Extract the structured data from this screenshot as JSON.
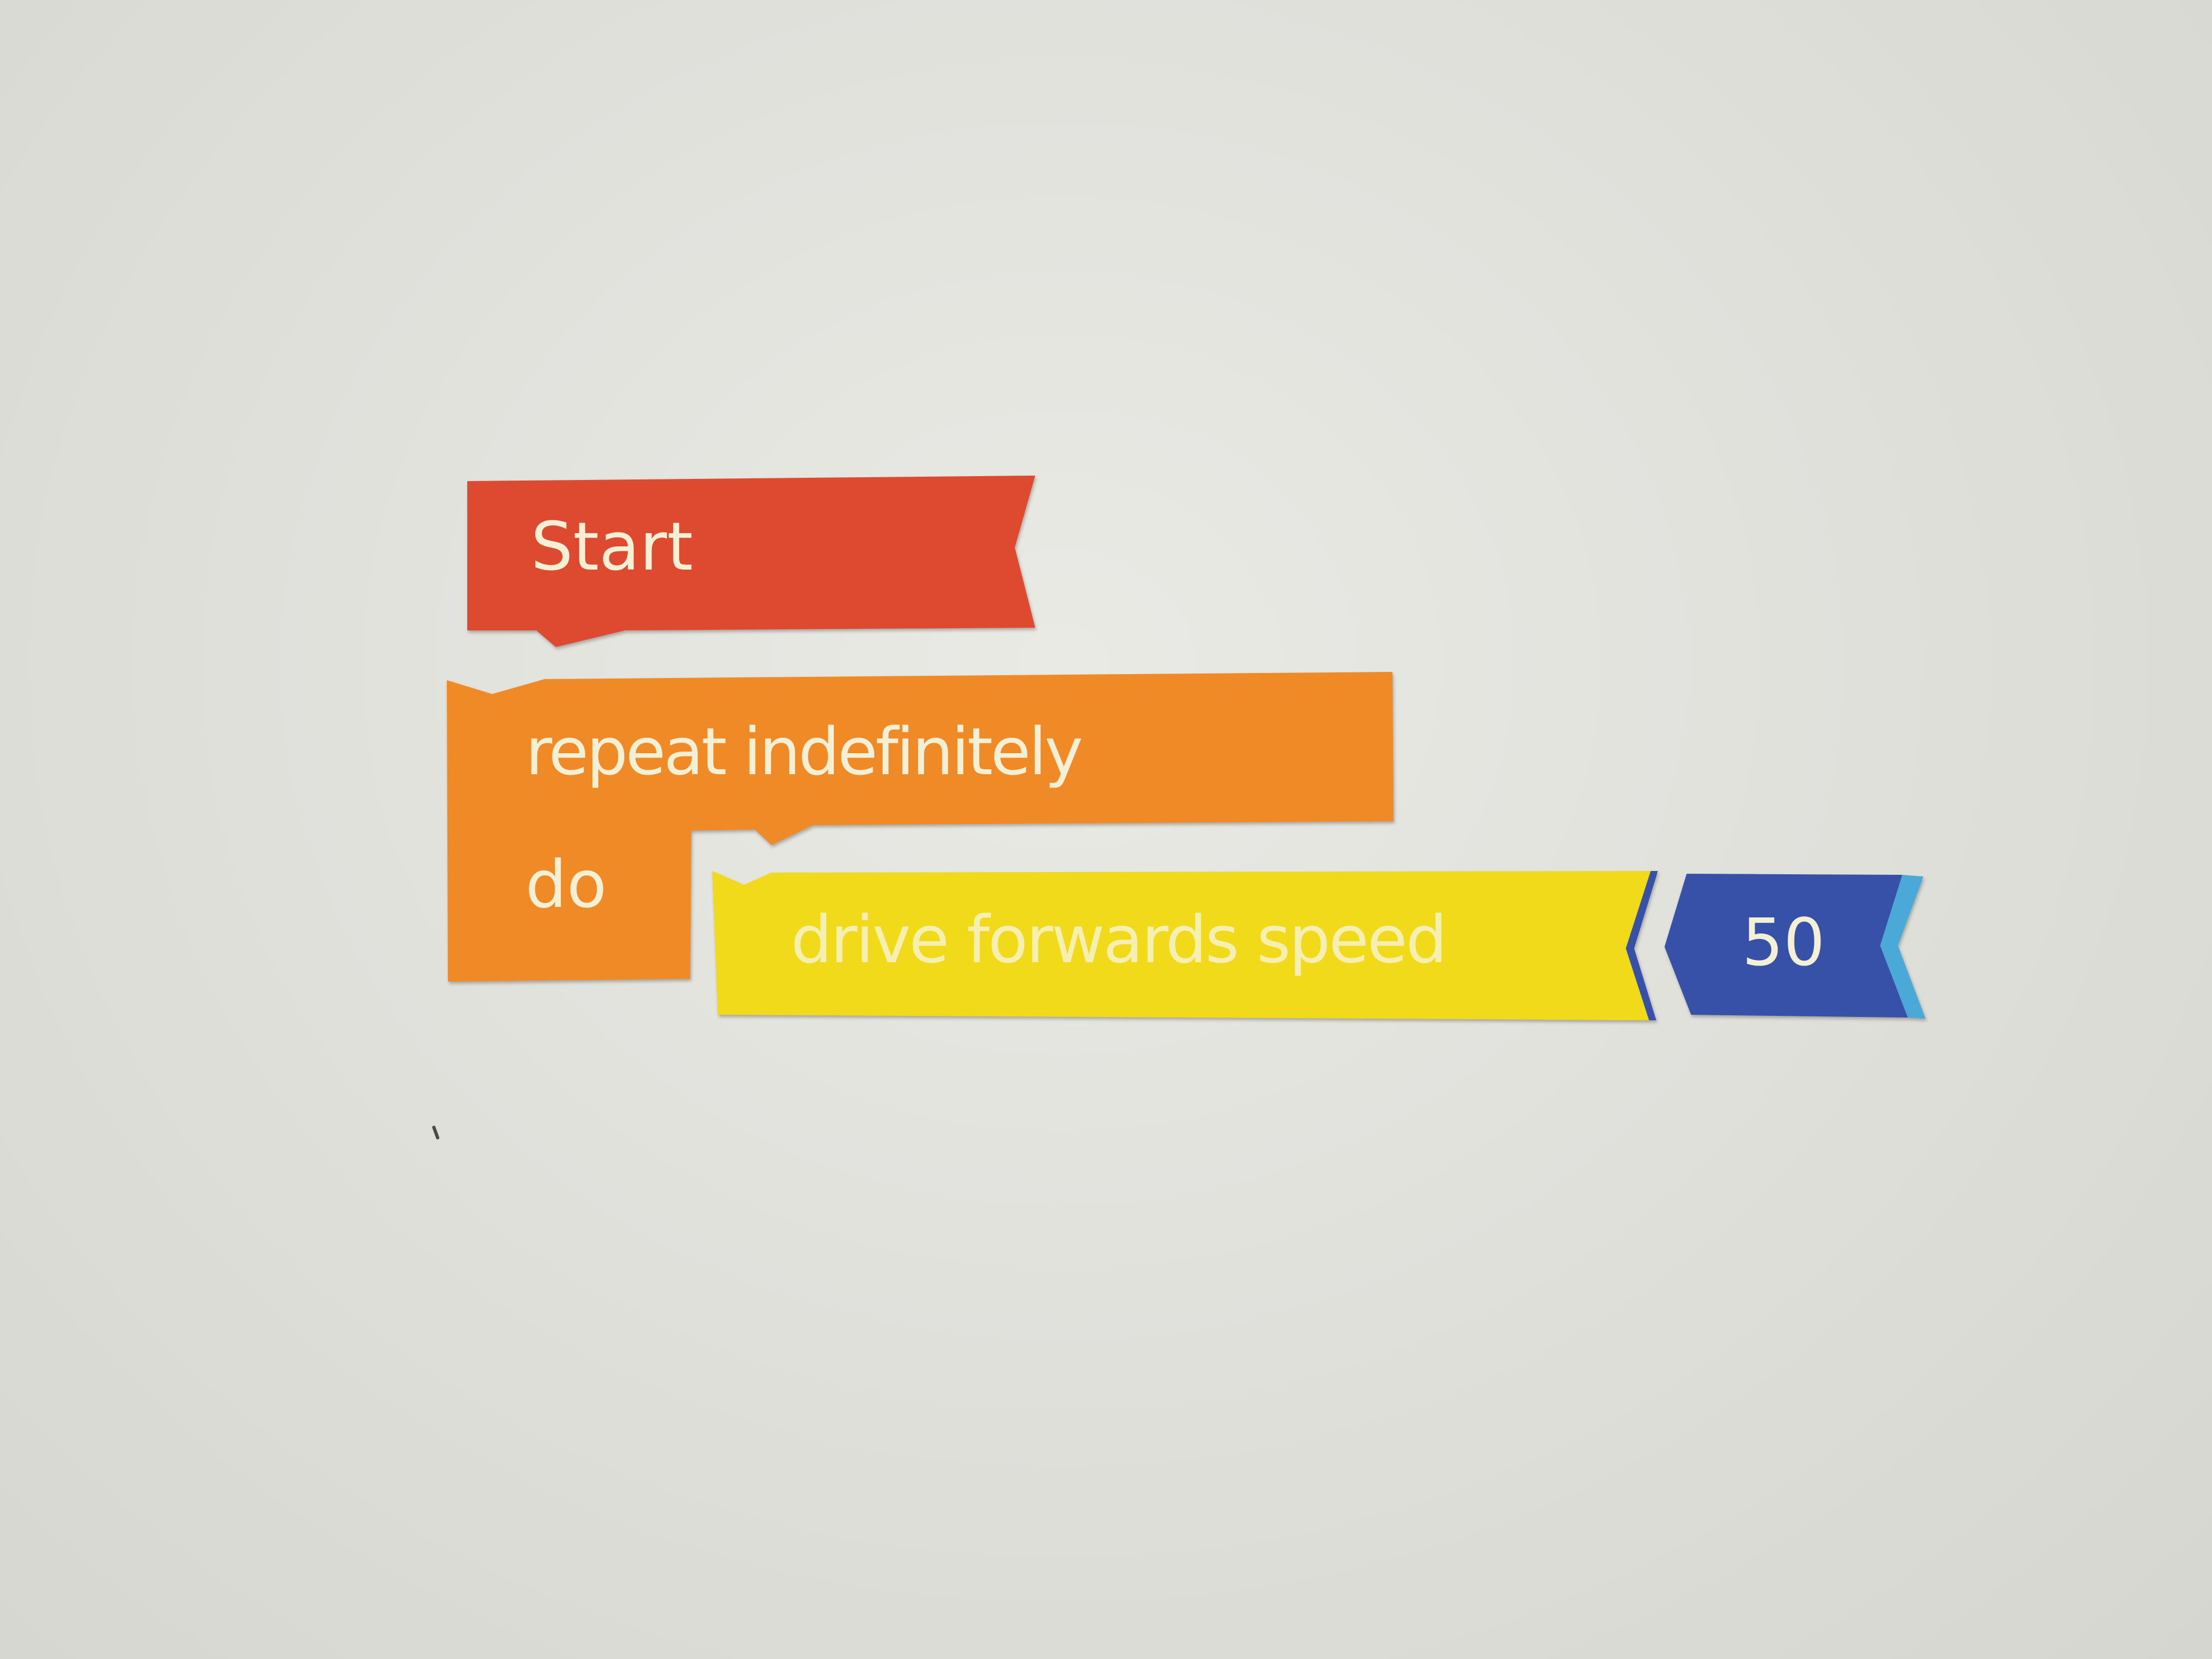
{
  "blocks": {
    "start": {
      "label": "Start",
      "color": "#de4a2f"
    },
    "repeat": {
      "label": "repeat indefinitely",
      "do_label": "do",
      "color": "#f08a26"
    },
    "drive": {
      "label": "drive forwards speed",
      "color": "#f1da1a"
    },
    "speed_value": {
      "label": "50",
      "color": "#3750a8",
      "edge_color": "#4aa9d6"
    }
  },
  "background_color": "#e2e2dd"
}
